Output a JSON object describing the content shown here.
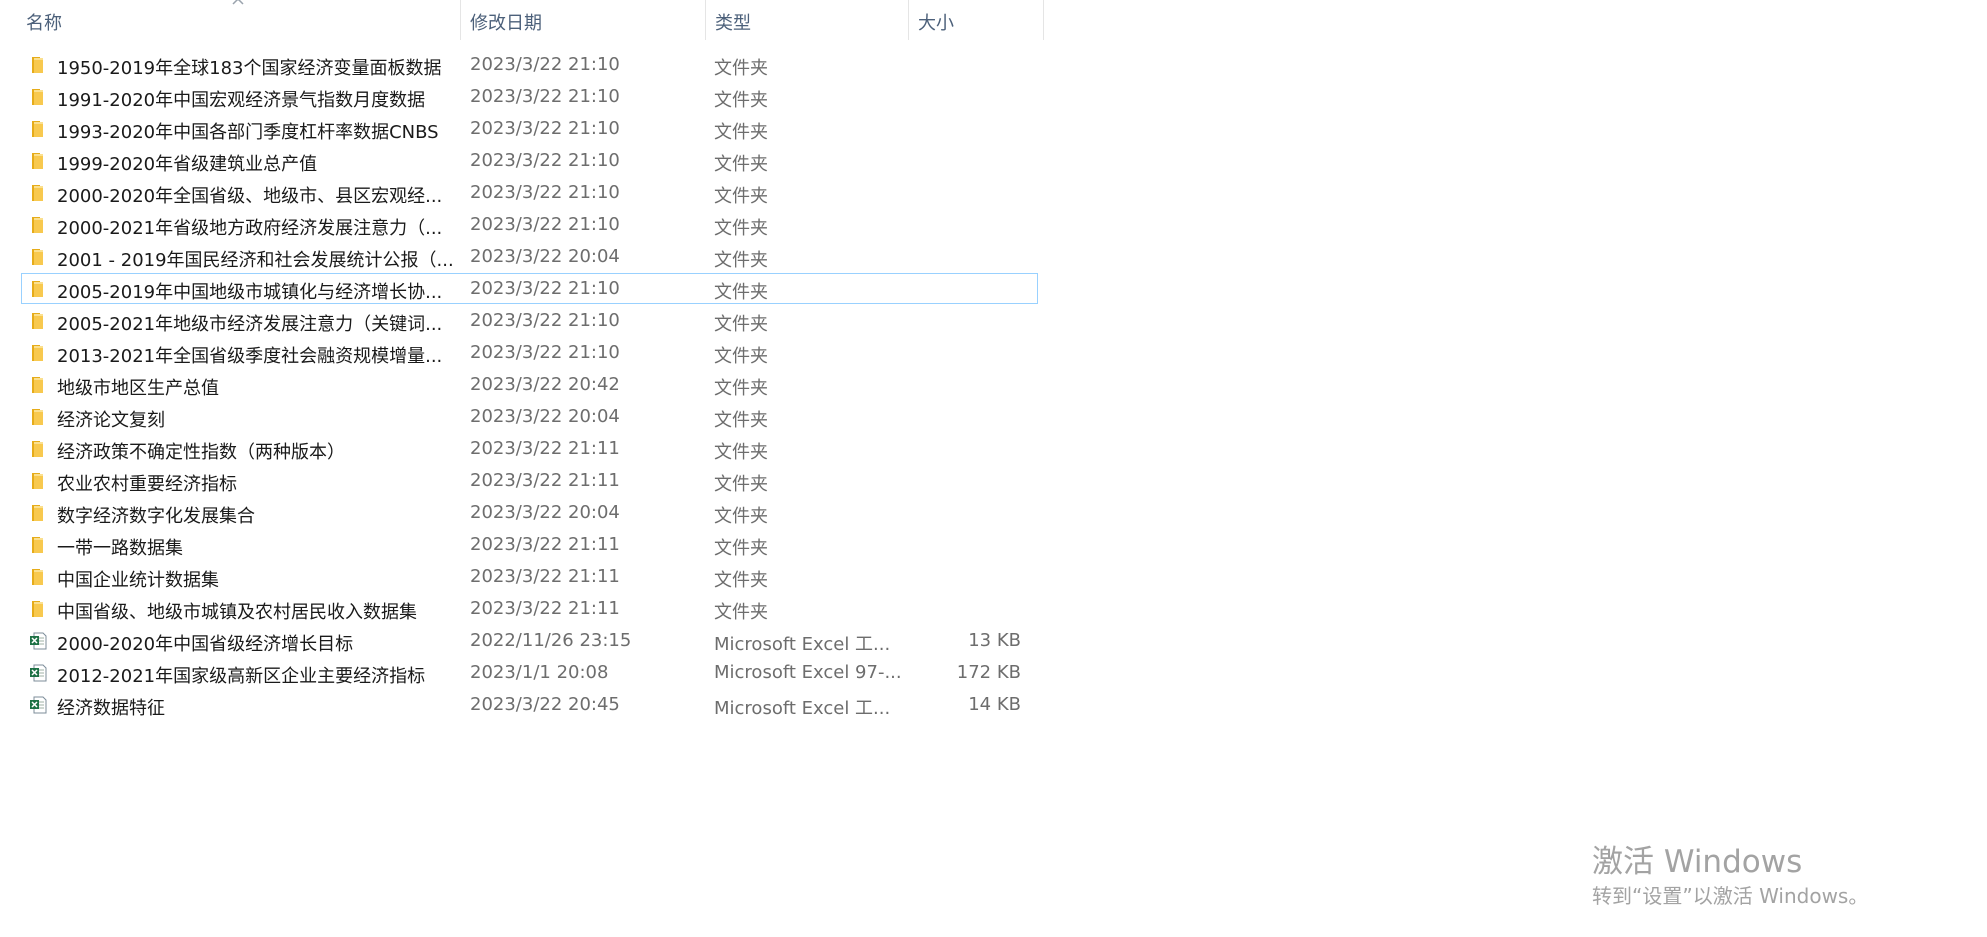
{
  "columns": {
    "name": "名称",
    "date": "修改日期",
    "type": "类型",
    "size": "大小"
  },
  "sort": {
    "column": "name",
    "direction": "ascending",
    "icon": "chevron-up-icon"
  },
  "files": [
    {
      "name": "1950-2019年全球183个国家经济变量面板数据",
      "date": "2023/3/22 21:10",
      "type": "文件夹",
      "size": "",
      "icon": "folder-icon"
    },
    {
      "name": "1991-2020年中国宏观经济景气指数月度数据",
      "date": "2023/3/22 21:10",
      "type": "文件夹",
      "size": "",
      "icon": "folder-icon"
    },
    {
      "name": "1993-2020年中国各部门季度杠杆率数据CNBS",
      "date": "2023/3/22 21:10",
      "type": "文件夹",
      "size": "",
      "icon": "folder-icon"
    },
    {
      "name": "1999-2020年省级建筑业总产值",
      "date": "2023/3/22 21:10",
      "type": "文件夹",
      "size": "",
      "icon": "folder-icon"
    },
    {
      "name": "2000-2020年全国省级、地级市、县区宏观经...",
      "date": "2023/3/22 21:10",
      "type": "文件夹",
      "size": "",
      "icon": "folder-icon"
    },
    {
      "name": "2000-2021年省级地方政府经济发展注意力（...",
      "date": "2023/3/22 21:10",
      "type": "文件夹",
      "size": "",
      "icon": "folder-icon"
    },
    {
      "name": "2001 - 2019年国民经济和社会发展统计公报（...",
      "date": "2023/3/22 20:04",
      "type": "文件夹",
      "size": "",
      "icon": "folder-icon"
    },
    {
      "name": "2005-2019年中国地级市城镇化与经济增长协...",
      "date": "2023/3/22 21:10",
      "type": "文件夹",
      "size": "",
      "icon": "folder-icon",
      "focused": true
    },
    {
      "name": "2005-2021年地级市经济发展注意力（关键词...",
      "date": "2023/3/22 21:10",
      "type": "文件夹",
      "size": "",
      "icon": "folder-icon"
    },
    {
      "name": "2013-2021年全国省级季度社会融资规模增量...",
      "date": "2023/3/22 21:10",
      "type": "文件夹",
      "size": "",
      "icon": "folder-icon"
    },
    {
      "name": "地级市地区生产总值",
      "date": "2023/3/22 20:42",
      "type": "文件夹",
      "size": "",
      "icon": "folder-icon"
    },
    {
      "name": "经济论文复刻",
      "date": "2023/3/22 20:04",
      "type": "文件夹",
      "size": "",
      "icon": "folder-icon"
    },
    {
      "name": "经济政策不确定性指数（两种版本）",
      "date": "2023/3/22 21:11",
      "type": "文件夹",
      "size": "",
      "icon": "folder-icon"
    },
    {
      "name": "农业农村重要经济指标",
      "date": "2023/3/22 21:11",
      "type": "文件夹",
      "size": "",
      "icon": "folder-icon"
    },
    {
      "name": "数字经济数字化发展集合",
      "date": "2023/3/22 20:04",
      "type": "文件夹",
      "size": "",
      "icon": "folder-icon"
    },
    {
      "name": "一带一路数据集",
      "date": "2023/3/22 21:11",
      "type": "文件夹",
      "size": "",
      "icon": "folder-icon"
    },
    {
      "name": "中国企业统计数据集",
      "date": "2023/3/22 21:11",
      "type": "文件夹",
      "size": "",
      "icon": "folder-icon"
    },
    {
      "name": "中国省级、地级市城镇及农村居民收入数据集",
      "date": "2023/3/22 21:11",
      "type": "文件夹",
      "size": "",
      "icon": "folder-icon"
    },
    {
      "name": "2000-2020年中国省级经济增长目标",
      "date": "2022/11/26 23:15",
      "type": "Microsoft Excel 工...",
      "size": "13 KB",
      "icon": "excel-file-icon"
    },
    {
      "name": "2012-2021年国家级高新区企业主要经济指标",
      "date": "2023/1/1 20:08",
      "type": "Microsoft Excel 97-...",
      "size": "172 KB",
      "icon": "excel-file-icon"
    },
    {
      "name": "经济数据特征",
      "date": "2023/3/22 20:45",
      "type": "Microsoft Excel 工...",
      "size": "14 KB",
      "icon": "excel-file-icon"
    }
  ],
  "watermark": {
    "title": "激活 Windows",
    "subtitle": "转到“设置”以激活 Windows。"
  },
  "colors": {
    "folder": "#f8c94f",
    "folder_dark": "#e6ac1a",
    "excel": "#1e7145",
    "focus_border": "#99d1ff",
    "header_text": "#4c607a",
    "secondary_text": "#6d6d6d",
    "watermark_text": "#a3a3a3"
  }
}
